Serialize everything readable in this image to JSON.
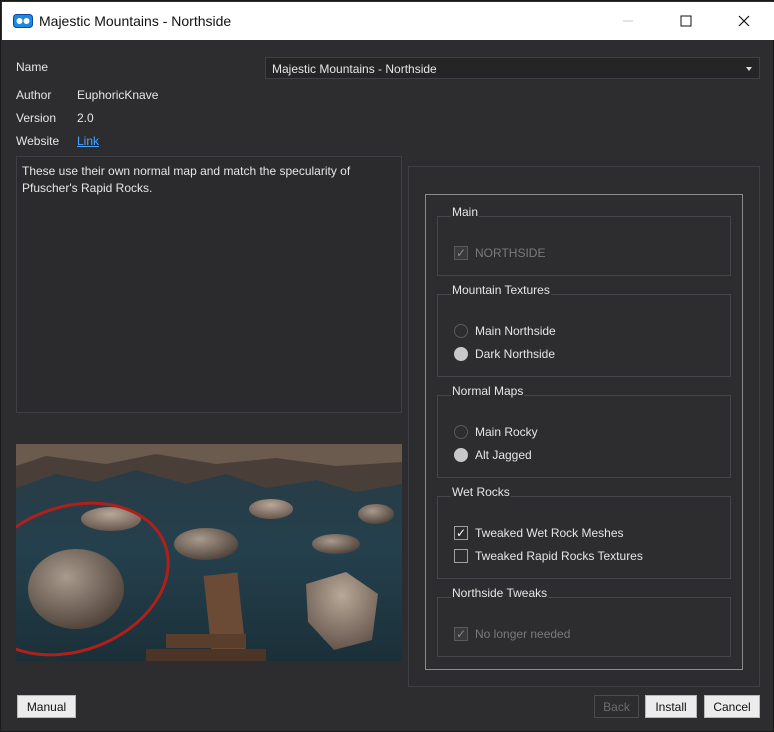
{
  "window": {
    "title": "Majestic Mountains - Northside",
    "icons": [
      "app-icon",
      "minimize-icon",
      "maximize-icon",
      "close-icon"
    ]
  },
  "info": {
    "name_label": "Name",
    "name_value": "Majestic Mountains - Northside",
    "author_label": "Author",
    "author_value": "EuphoricKnave",
    "version_label": "Version",
    "version_value": "2.0",
    "website_label": "Website",
    "website_link": "Link"
  },
  "description": "These use their own normal map and match the specularity of Pfuscher's Rapid Rocks.",
  "groups": [
    {
      "title": "Main",
      "options": [
        {
          "label": "NORTHSIDE",
          "type": "checkbox",
          "checked": true,
          "disabled": true
        }
      ]
    },
    {
      "title": "Mountain Textures",
      "options": [
        {
          "label": "Main Northside",
          "type": "radio",
          "checked": false
        },
        {
          "label": "Dark Northside",
          "type": "radio",
          "checked": true
        }
      ]
    },
    {
      "title": "Normal Maps",
      "options": [
        {
          "label": "Main Rocky",
          "type": "radio",
          "checked": false
        },
        {
          "label": "Alt Jagged",
          "type": "radio",
          "checked": true
        }
      ]
    },
    {
      "title": "Wet Rocks",
      "options": [
        {
          "label": "Tweaked Wet Rock Meshes",
          "type": "checkbox",
          "checked": true
        },
        {
          "label": "Tweaked Rapid Rocks Textures",
          "type": "checkbox",
          "checked": false
        }
      ]
    },
    {
      "title": "Northside Tweaks",
      "options": [
        {
          "label": "No longer needed",
          "type": "checkbox",
          "checked": true,
          "disabled": true
        }
      ]
    }
  ],
  "buttons": {
    "manual": "Manual",
    "back": "Back",
    "install": "Install",
    "cancel": "Cancel"
  },
  "colors": {
    "background": "#2d2d30",
    "link": "#4aa3ff",
    "titlebar": "#ffffff"
  }
}
